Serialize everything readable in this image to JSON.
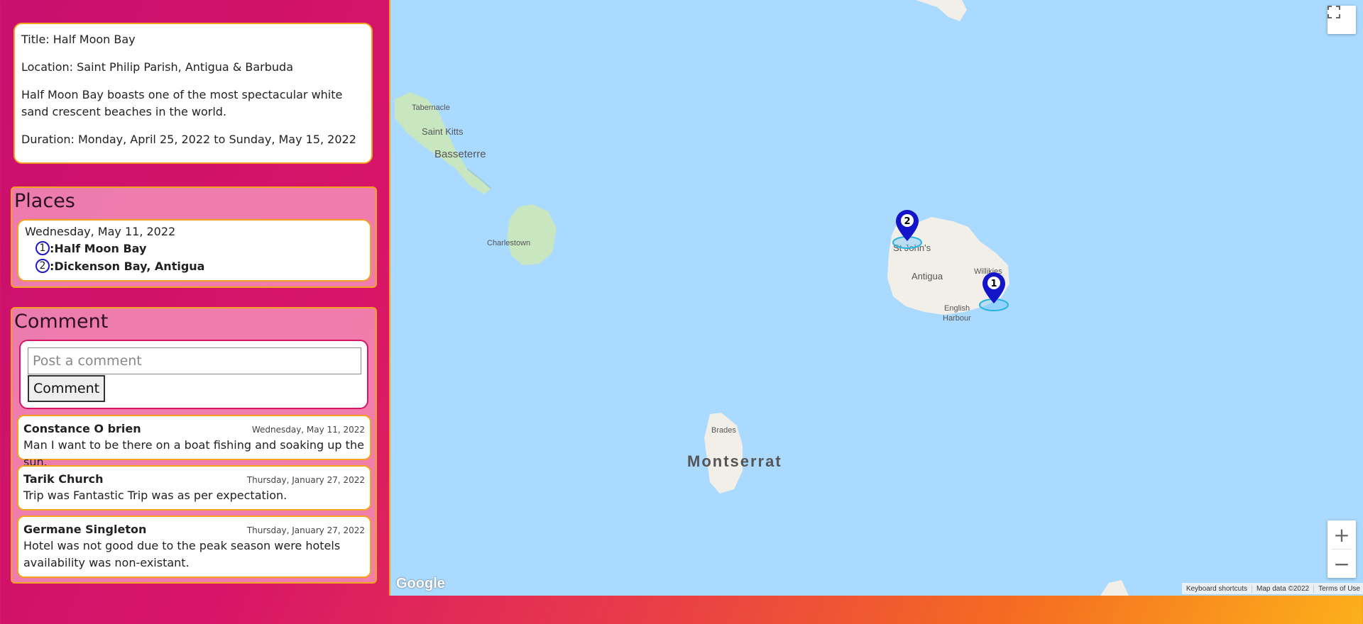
{
  "trip": {
    "title": "Title: Half Moon Bay",
    "location": "Location: Saint Philip Parish, Antigua & Barbuda",
    "description": "Half Moon Bay boasts one of the most spectacular white sand crescent beaches in the world.",
    "duration": "Duration: Monday, April 25, 2022 to Sunday, May 15, 2022"
  },
  "places": {
    "heading": "Places",
    "date": "Wednesday, May 11, 2022",
    "items": [
      {
        "num": "1",
        "name": ":Half Moon Bay"
      },
      {
        "num": "2",
        "name": ":Dickenson Bay, Antigua"
      }
    ]
  },
  "comment_section": {
    "heading": "Comment",
    "placeholder": "Post a comment",
    "button_label": "Comment",
    "comments": [
      {
        "author": "Constance O brien",
        "date": "Wednesday, May 11, 2022",
        "text": "Man I want to be there on a boat fishing and soaking up the sun."
      },
      {
        "author": "Tarik Church",
        "date": "Thursday, January 27, 2022",
        "text": "Trip was Fantastic Trip was as per expectation."
      },
      {
        "author": "Germane Singleton",
        "date": "Thursday, January 27, 2022",
        "text": "Hotel was not good due to the peak season were hotels availability was non-existant."
      }
    ]
  },
  "map": {
    "labels": {
      "tabernacle": "Tabernacle",
      "saint_kitts": "Saint Kitts",
      "basseterre": "Basseterre",
      "charlestown": "Charlestown",
      "st_johns": "St John's",
      "antigua": "Antigua",
      "willikies": "Willikies",
      "english": "English",
      "harbour": "Harbour",
      "brades": "Brades",
      "montserrat": "Montserrat"
    },
    "markers": [
      "1",
      "2"
    ],
    "logo": "Google",
    "attribution": [
      "Keyboard shortcuts",
      "Map data ©2022",
      "Terms of Use"
    ],
    "controls": {
      "zoom_in": "+",
      "zoom_out": "−"
    },
    "colors": {
      "water": "#aadaff",
      "land": "#f2efe9",
      "park": "#c8e6c0",
      "marker": "#1414c8"
    }
  }
}
